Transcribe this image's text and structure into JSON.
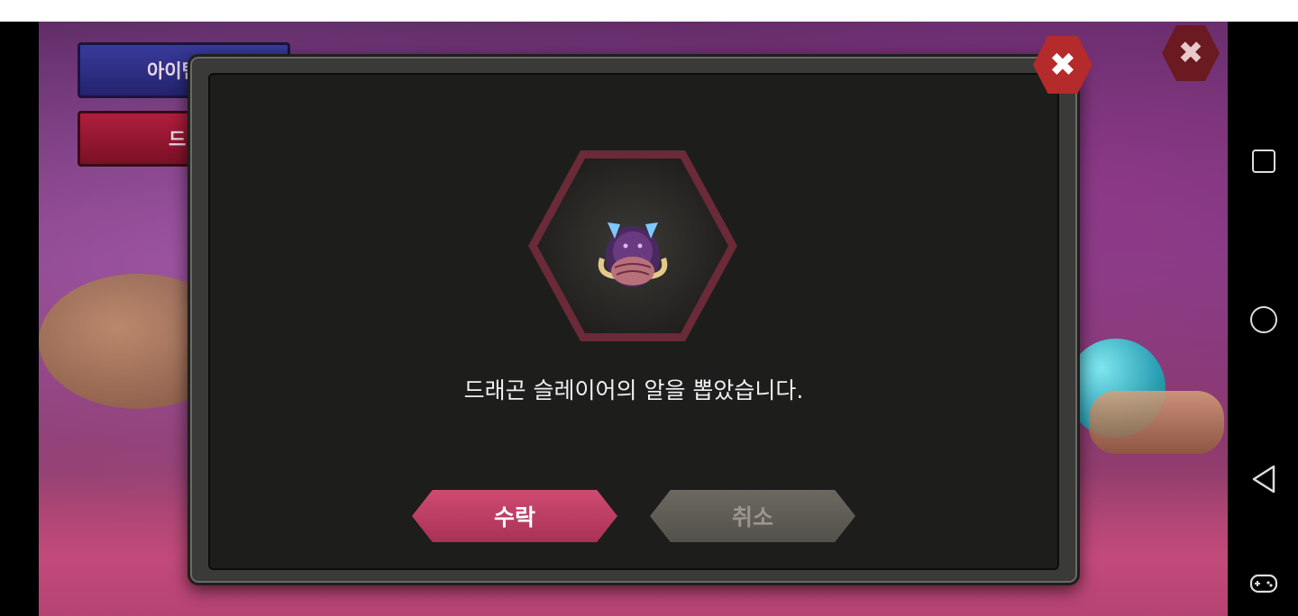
{
  "side_menu": {
    "item_code_label": "아이템코",
    "devil_label": "드빌 가"
  },
  "dialog": {
    "message": "드래곤 슬레이어의 알을 뽑았습니다.",
    "accept_label": "수락",
    "cancel_label": "취소",
    "reward_icon": "dragon-slayer-egg-icon"
  },
  "icons": {
    "close": "close-icon",
    "recents": "recents-square-icon",
    "home": "home-circle-icon",
    "back": "back-triangle-icon",
    "game_tools": "gamepad-icon"
  },
  "colors": {
    "accept_button": "#c63e64",
    "cancel_button": "#605d56",
    "close_button": "#b52a2a",
    "dialog_bg": "#1d1d1c"
  }
}
